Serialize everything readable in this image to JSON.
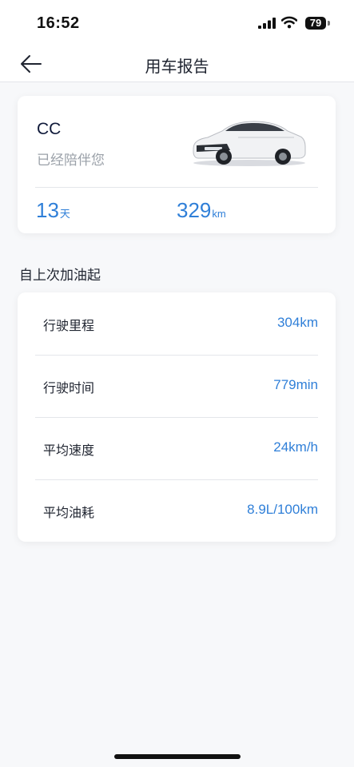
{
  "status_bar": {
    "time": "16:52",
    "battery": "79"
  },
  "header": {
    "title": "用车报告",
    "back_icon": "arrow-left-icon"
  },
  "car_card": {
    "name": "CC",
    "subtitle": "已经陪伴您",
    "days_value": "13",
    "days_unit": "天",
    "distance_value": "329",
    "distance_unit": "km"
  },
  "since_refuel": {
    "title": "自上次加油起",
    "items": [
      {
        "label": "行驶里程",
        "value": "304km"
      },
      {
        "label": "行驶时间",
        "value": "779min"
      },
      {
        "label": "平均速度",
        "value": "24km/h"
      },
      {
        "label": "平均油耗",
        "value": "8.9L/100km"
      }
    ]
  },
  "colors": {
    "accent": "#2f7fd8",
    "background": "#f7f8fa",
    "card": "#ffffff",
    "muted_text": "#9aa0a8"
  }
}
